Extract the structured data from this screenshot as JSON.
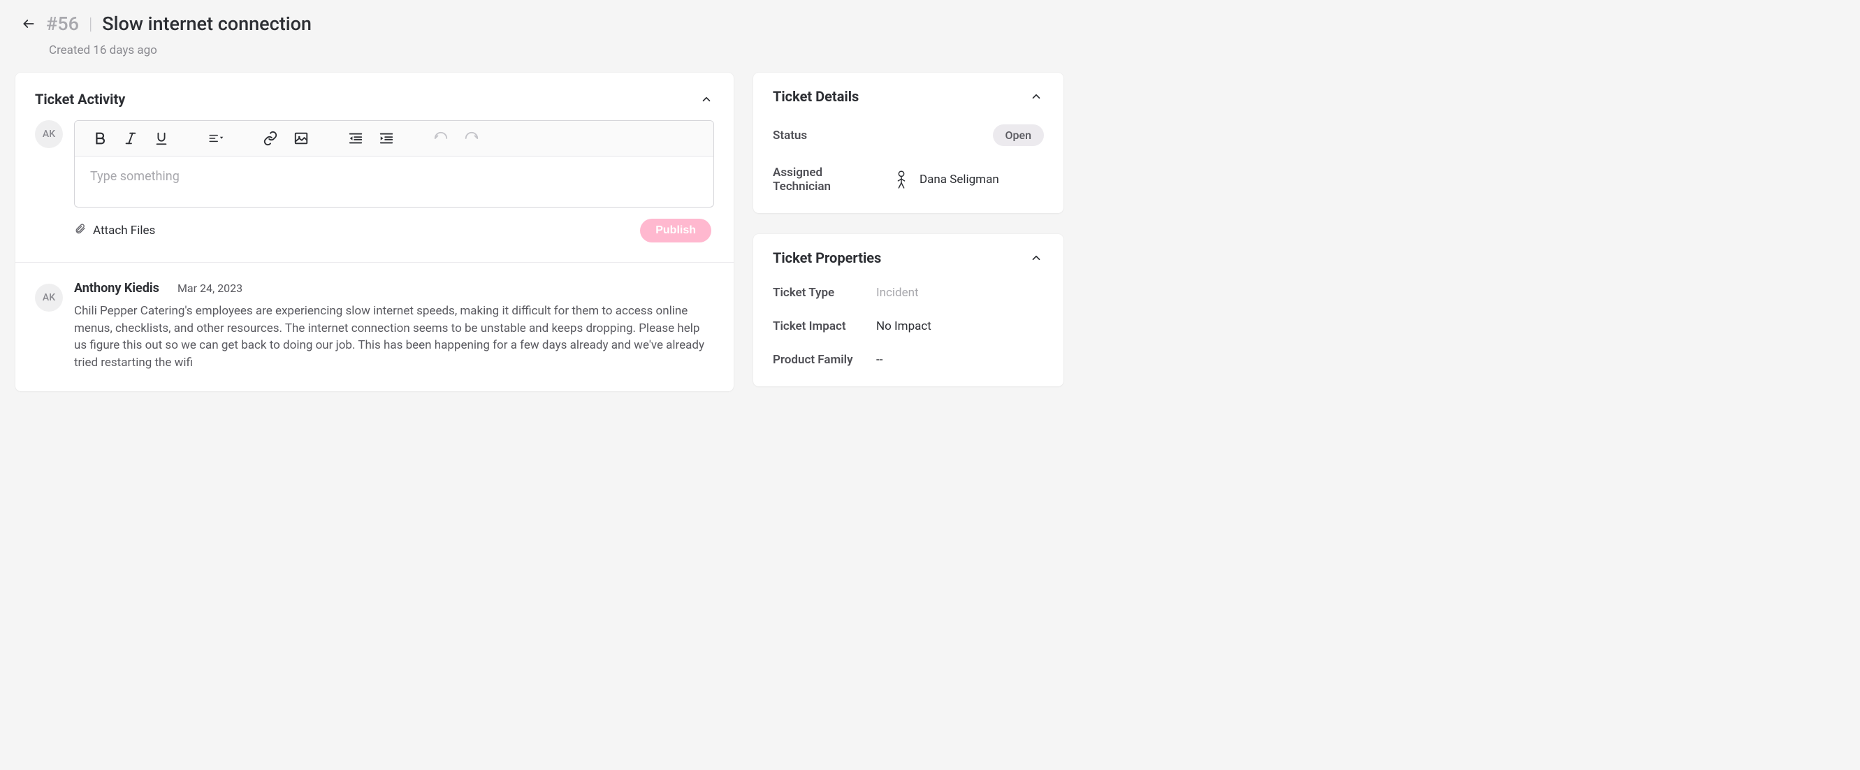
{
  "header": {
    "ticket_id": "#56",
    "title": "Slow internet connection",
    "created_text": "Created 16 days ago"
  },
  "activity": {
    "card_title": "Ticket Activity",
    "composer": {
      "avatar_initials": "AK",
      "placeholder": "Type something",
      "attach_label": "Attach Files",
      "publish_label": "Publish"
    },
    "comments": [
      {
        "avatar_initials": "AK",
        "author": "Anthony Kiedis",
        "date": "Mar 24, 2023",
        "body": "Chili Pepper Catering's employees are experiencing slow internet speeds, making it difficult for them to access online menus, checklists, and other resources. The internet connection seems to be unstable and keeps dropping. Please help us figure this out so we can get back to doing our job. This has been happening for a few days already and we've already tried restarting the wifi"
      }
    ]
  },
  "details": {
    "card_title": "Ticket Details",
    "status_label": "Status",
    "status_value": "Open",
    "technician_label": "Assigned Technician",
    "technician_value": "Dana Seligman"
  },
  "properties": {
    "card_title": "Ticket Properties",
    "type_label": "Ticket Type",
    "type_value": "Incident",
    "impact_label": "Ticket Impact",
    "impact_value": "No Impact",
    "family_label": "Product Family",
    "family_value": "--"
  }
}
